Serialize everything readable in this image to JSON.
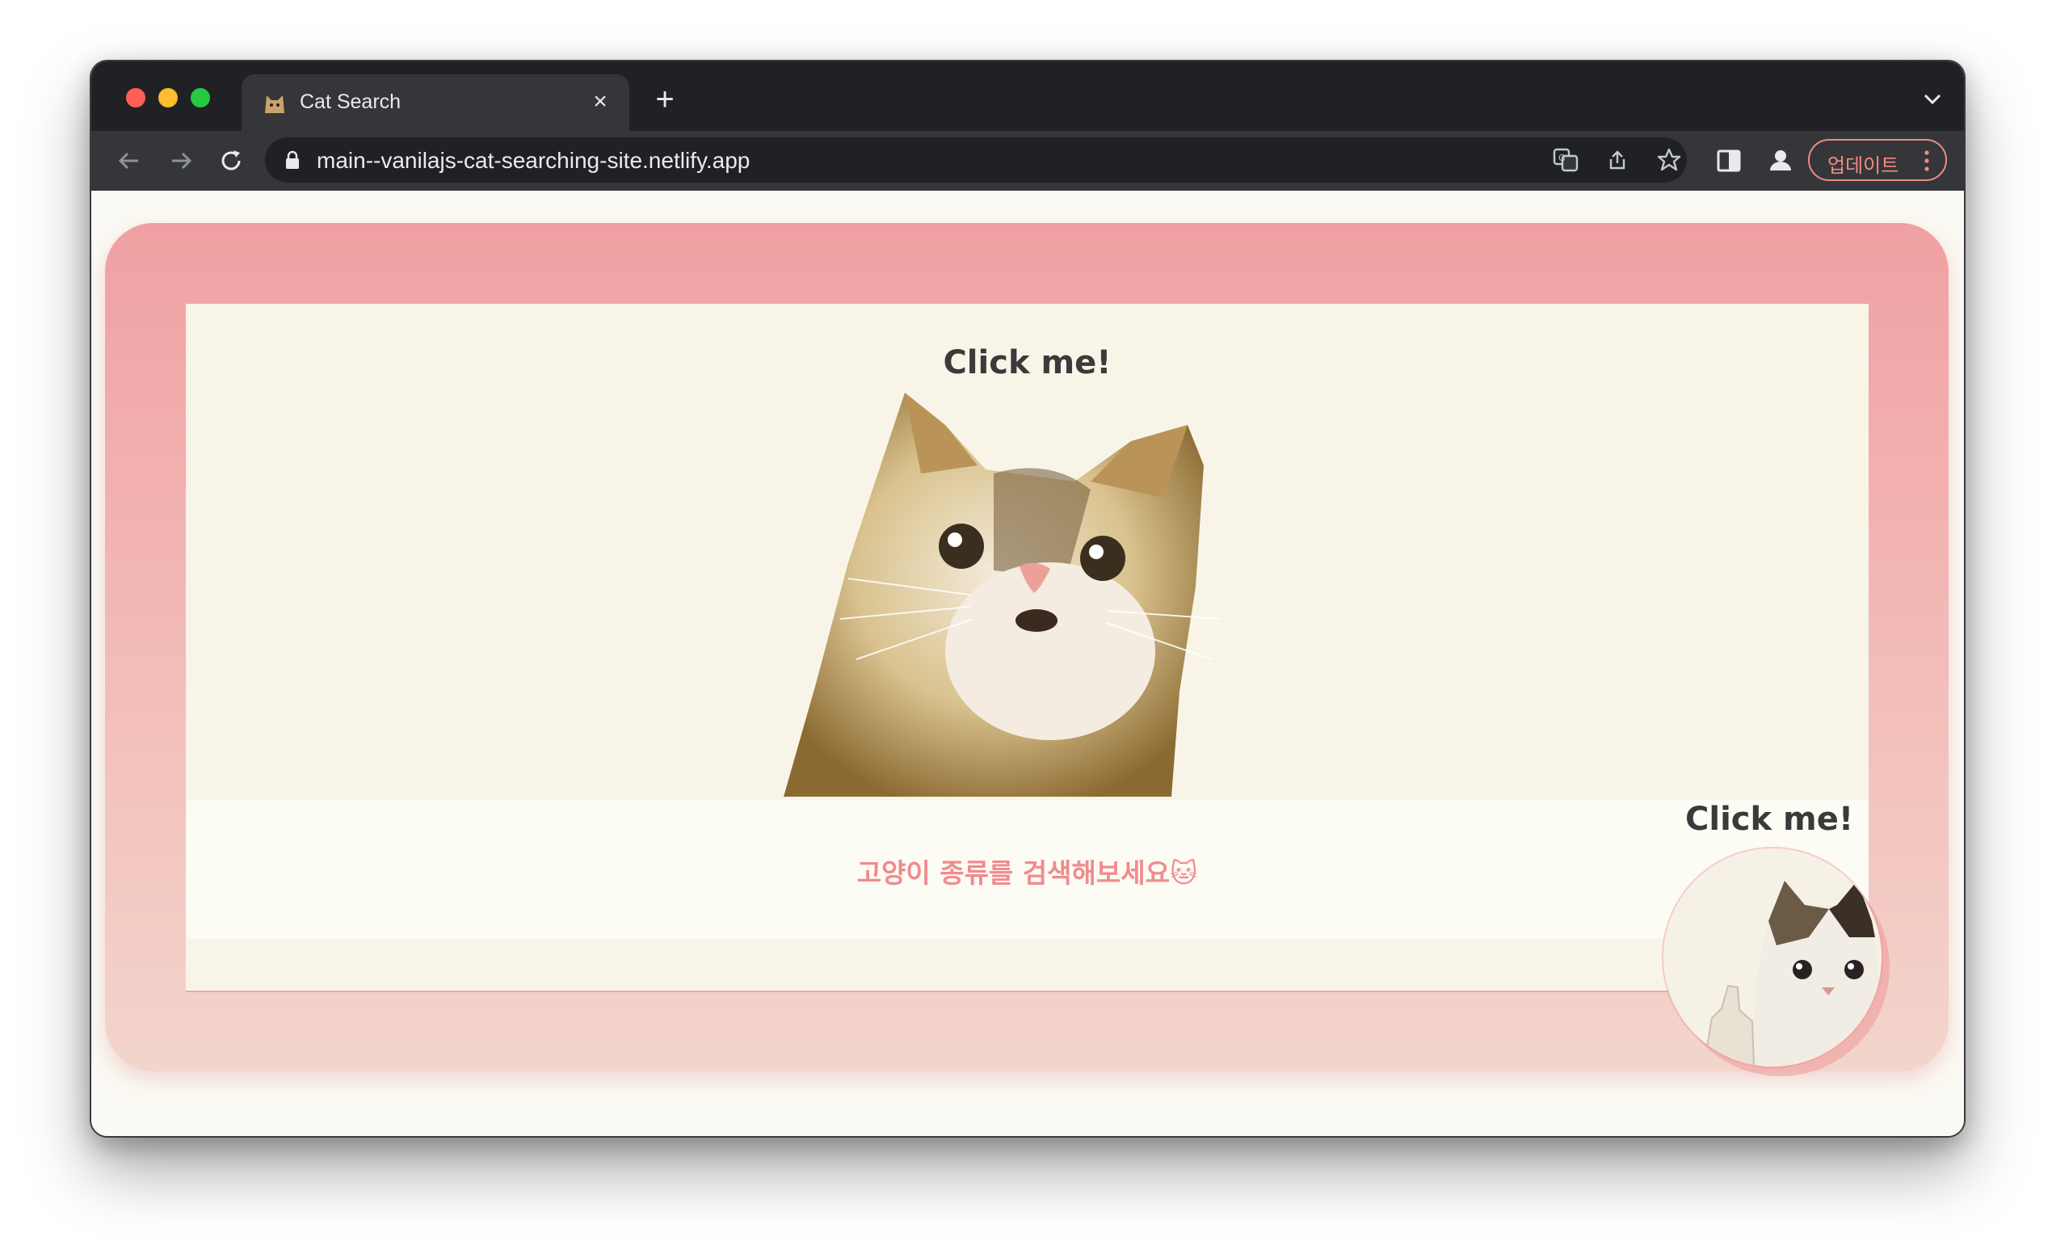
{
  "browser": {
    "tab_title": "Cat Search",
    "tab_favicon": "cat-face-icon",
    "url": "main--vanilajs-cat-searching-site.netlify.app",
    "update_label": "업데이트"
  },
  "page": {
    "main_click_label": "Click me!",
    "search_prompt": "고양이 종류를 검색해보세요🐱",
    "floating_click_label": "Click me!"
  },
  "colors": {
    "frame_top": "#f0a0a2",
    "frame_bottom": "#f3d5cc",
    "accent_text": "#f08b8d",
    "panel_bg": "#f8f5e8"
  }
}
